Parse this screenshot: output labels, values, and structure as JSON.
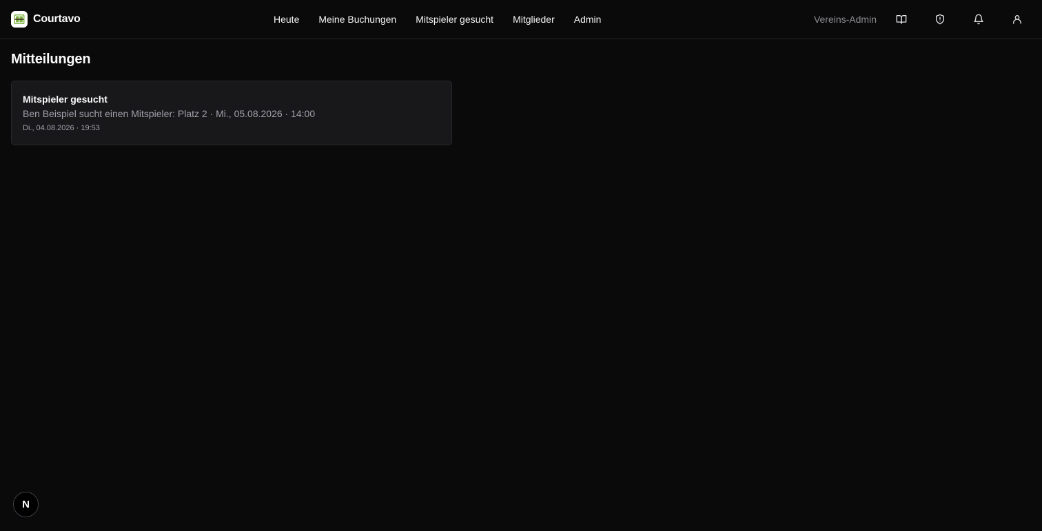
{
  "brand": {
    "name": "Courtavo",
    "logo_icon": "court-logo-icon"
  },
  "nav": {
    "items": [
      {
        "label": "Heute"
      },
      {
        "label": "Meine Buchungen"
      },
      {
        "label": "Mitspieler gesucht"
      },
      {
        "label": "Mitglieder"
      },
      {
        "label": "Admin"
      }
    ]
  },
  "header_right": {
    "role_label": "Vereins-Admin",
    "icons": [
      "book-icon",
      "shield-icon",
      "bell-icon",
      "user-icon"
    ]
  },
  "page": {
    "title": "Mitteilungen"
  },
  "notifications": [
    {
      "title": "Mitspieler gesucht",
      "body": "Ben Beispiel sucht einen Mitspieler: Platz 2 · Mi., 05.08.2026 · 14:00",
      "timestamp": "Di., 04.08.2026 · 19:53"
    }
  ],
  "dev_badge": {
    "label": "N"
  },
  "colors": {
    "background": "#0a0a0b",
    "card": "#18181b",
    "border": "#27272a",
    "muted_text": "#a1a1aa",
    "logo_green": "#7cb342"
  }
}
